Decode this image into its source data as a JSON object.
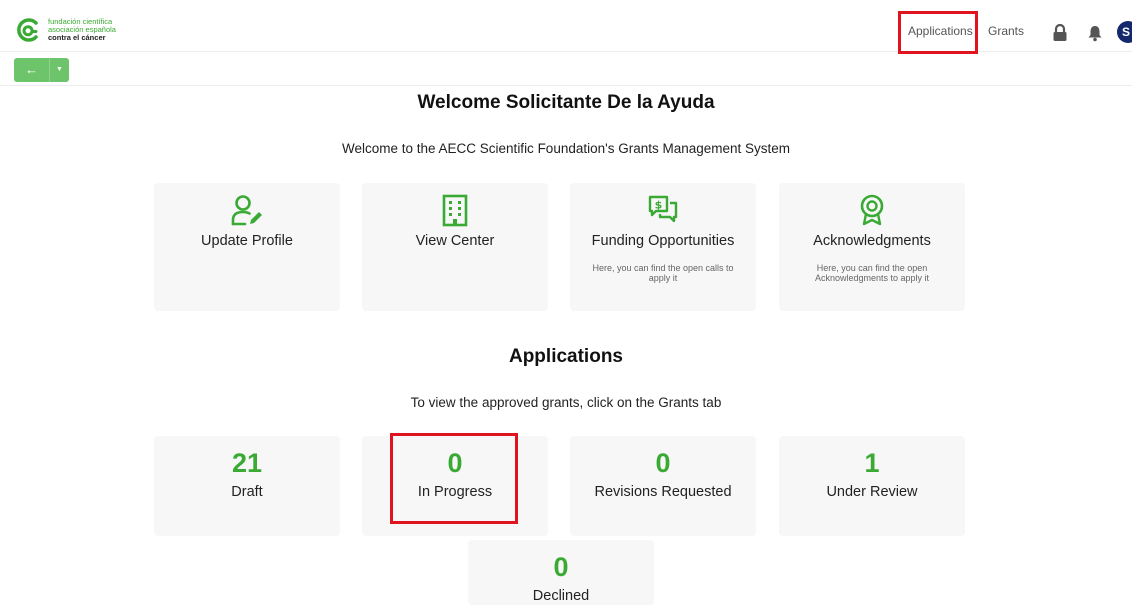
{
  "brand": {
    "line1": "fundación científica",
    "line2": "asociación española",
    "line3": "contra el cáncer",
    "color": "#3aaa35"
  },
  "topnav": {
    "applications": "Applications",
    "grants": "Grants",
    "avatar_initial": "S",
    "icons": [
      "lock-icon",
      "bell-icon"
    ]
  },
  "welcome": {
    "title": "Welcome Solicitante De la Ayuda",
    "subtitle": "Welcome to the AECC Scientific Foundation's Grants Management System"
  },
  "cards": [
    {
      "icon": "user-edit-icon",
      "label": "Update Profile",
      "desc": ""
    },
    {
      "icon": "building-icon",
      "label": "View Center",
      "desc": ""
    },
    {
      "icon": "funding-chat-icon",
      "label": "Funding Opportunities",
      "desc": "Here, you can find the open calls to apply it"
    },
    {
      "icon": "award-icon",
      "label": "Acknowledgments",
      "desc": "Here, you can find the open Acknowledgments to apply it"
    }
  ],
  "applications": {
    "title": "Applications",
    "subtitle": "To view the approved grants, click on the Grants tab",
    "stats": [
      {
        "value": "21",
        "label": "Draft"
      },
      {
        "value": "0",
        "label": "In Progress"
      },
      {
        "value": "0",
        "label": "Revisions Requested"
      },
      {
        "value": "1",
        "label": "Under Review"
      },
      {
        "value": "0",
        "label": "Declined"
      }
    ]
  },
  "colors": {
    "accent": "#3aaa35",
    "highlight": "#e0141e",
    "avatar": "#15286b"
  }
}
